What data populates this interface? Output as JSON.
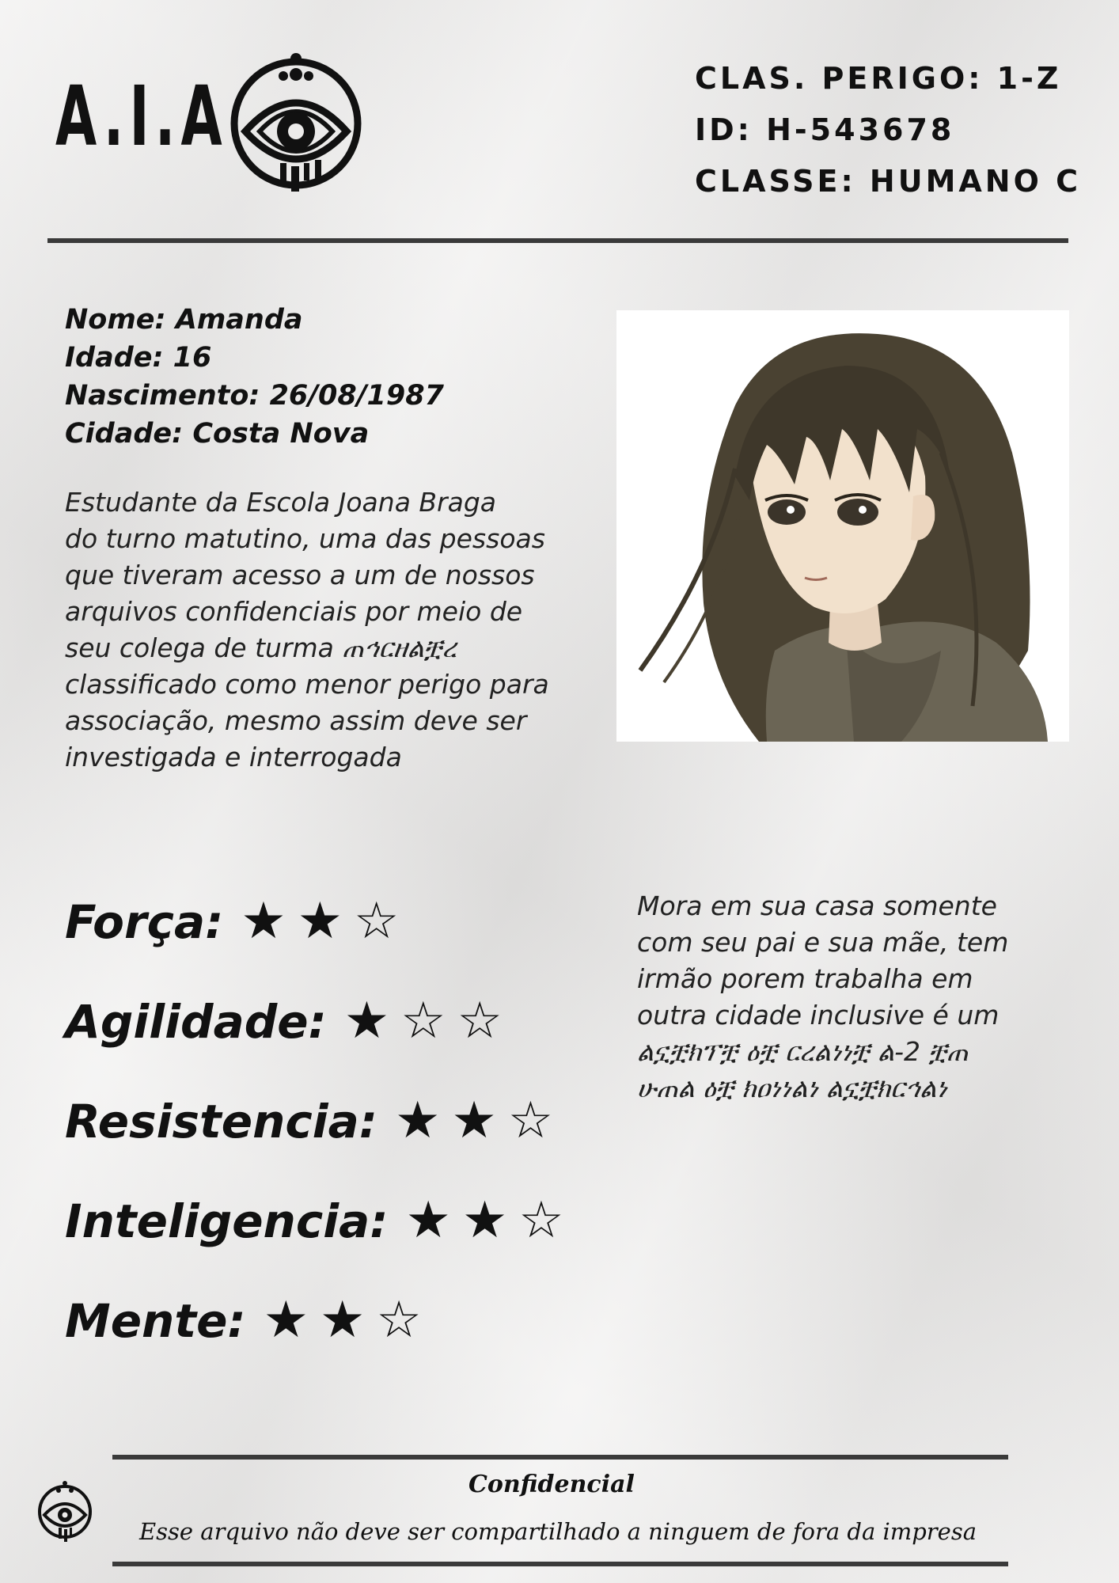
{
  "header": {
    "logo_text": "A.I.A",
    "danger_class": "CLAS. PERIGO: 1-Z",
    "id": "ID: H-543678",
    "class": "CLASSE: HUMANO C"
  },
  "profile": {
    "name": "Nome: Amanda",
    "age": "Idade: 16",
    "birth": "Nascimento: 26/08/1987",
    "city": "Cidade: Costa Nova",
    "description_lines": [
      "Estudante da Escola Joana Braga",
      "do turno matutino, uma das pessoas",
      "que tiveram acesso a um de nossos",
      "arquivos confidenciais por meio de",
      "seu colega de turma ጠኅርዘልቿረ",
      "classificado como menor perigo para",
      "associação, mesmo assim deve ser",
      "investigada e interrogada"
    ]
  },
  "stats": [
    {
      "label": "Força:",
      "stars": "★★☆",
      "value": 2,
      "max": 3
    },
    {
      "label": "Agilidade:",
      "stars": "★☆☆",
      "value": 1,
      "max": 3
    },
    {
      "label": "Resistencia:",
      "stars": "★★☆",
      "value": 2,
      "max": 3
    },
    {
      "label": "Inteligencia:",
      "stars": "★★☆",
      "value": 2,
      "max": 3
    },
    {
      "label": "Mente:",
      "stars": "★★☆",
      "value": 2,
      "max": 3
    }
  ],
  "side_note_lines": [
    "Mora em sua casa somente",
    "com seu pai e sua mãe, tem",
    "irmão porem trabalha em",
    "outra cidade inclusive é um",
    "ልኗቿክፕቿ ዕቿ ርረልነነቿ ል-2 ቿጠ",
    "ሁጠል ዕቿ ክዐነነልነ ልኗቿክርኅልነ"
  ],
  "footer": {
    "title": "Confidencial",
    "text": "Esse arquivo não deve ser compartilhado a ninguem de fora da impresa"
  },
  "colors": {
    "paper": "#ecebea",
    "ink": "#111111",
    "rule": "#3a3a3a"
  },
  "icons": {
    "logo": "eye-emblem-icon",
    "footer": "eye-emblem-icon"
  }
}
